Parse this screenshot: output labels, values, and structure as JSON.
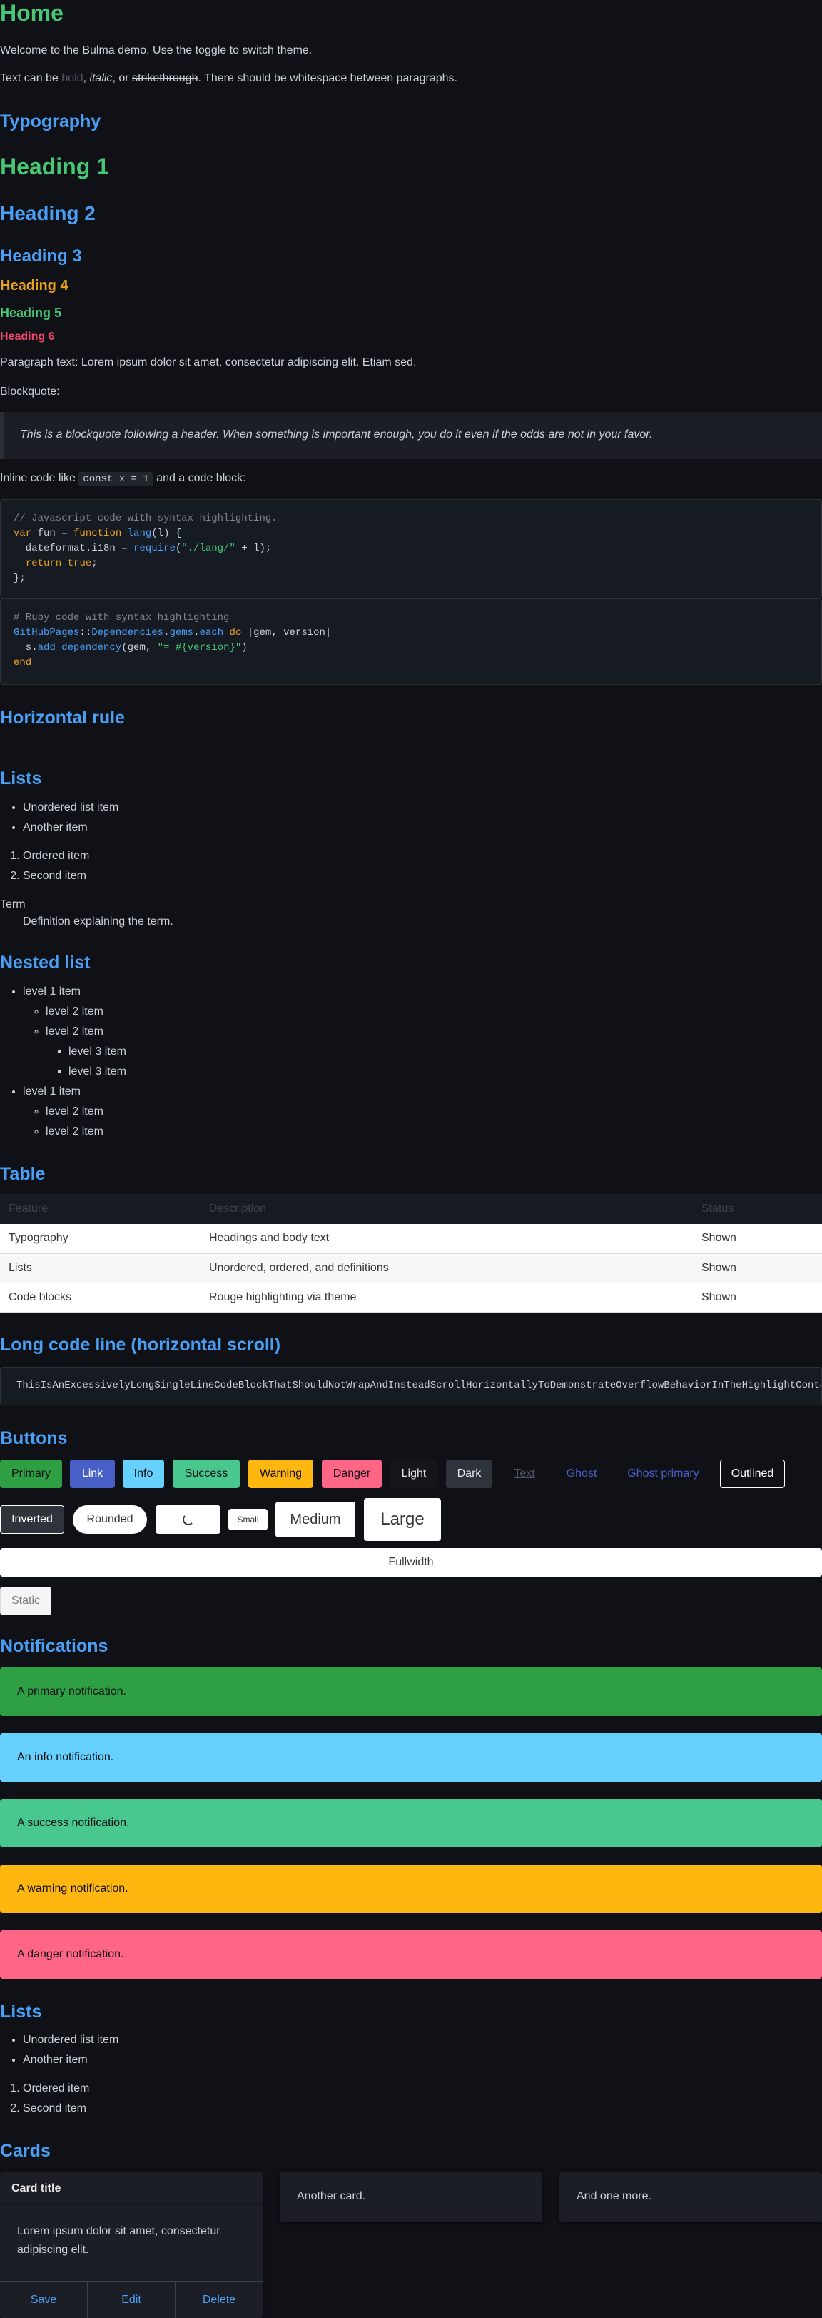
{
  "page": {
    "title": "Home",
    "intro": "Welcome to the Bulma demo. Use the toggle to switch theme.",
    "text_styles": {
      "prefix": "Text can be ",
      "bold": "bold",
      "comma1": ", ",
      "italic": "italic",
      "comma2": ", or ",
      "strike": "strikethrough",
      "suffix": ". There should be whitespace between paragraphs."
    }
  },
  "typography": {
    "heading": "Typography",
    "h1": "Heading 1",
    "h2": "Heading 2",
    "h3": "Heading 3",
    "h4": "Heading 4",
    "h5": "Heading 5",
    "h6": "Heading 6",
    "paragraph": "Paragraph text: Lorem ipsum dolor sit amet, consectetur adipiscing elit. Etiam sed.",
    "blockquote_label": "Blockquote:",
    "blockquote": "This is a blockquote following a header. When something is important enough, you do it even if the odds are not in your favor.",
    "inline_prefix": "Inline code like ",
    "inline_code": "const x = 1",
    "inline_suffix": " and a code block:"
  },
  "code_js": {
    "comment": "// Javascript code with syntax highlighting.",
    "l2_var": "var",
    "l2_mid": " fun = ",
    "l2_function": "function",
    "l2_lang": "lang",
    "l2_end": "(l) {",
    "l3_a": "  dateformat.i18n = ",
    "l3_require": "require",
    "l3_b": "(",
    "l3_str": "\"./lang/\"",
    "l3_c": " + l);",
    "l4_return": "return",
    "l4_true": "true",
    "l4_end": ";",
    "l5": "};"
  },
  "code_ruby": {
    "comment": "# Ruby code with syntax highlighting",
    "l2_a": "GitHubPages",
    "l2_b": "::",
    "l2_c": "Dependencies",
    "l2_d": ".",
    "l2_e": "gems",
    "l2_f": ".",
    "l2_g": "each",
    "l2_h": " ",
    "l2_do": "do",
    "l2_rest": " |gem, version|",
    "l3_a": "  s.",
    "l3_fn": "add_dependency",
    "l3_b": "(gem, ",
    "l3_str": "\"= #{version}\"",
    "l3_c": ")",
    "l4": "end"
  },
  "hr": {
    "heading": "Horizontal rule"
  },
  "lists": {
    "heading": "Lists",
    "unordered": [
      "Unordered list item",
      "Another item"
    ],
    "ordered": [
      "Ordered item",
      "Second item"
    ],
    "dt": "Term",
    "dd": "Definition explaining the term."
  },
  "nested": {
    "heading": "Nested list",
    "l1a": "level 1 item",
    "l2a": "level 2 item",
    "l2b": "level 2 item",
    "l3a": "level 3 item",
    "l3b": "level 3 item",
    "l1b": "level 1 item",
    "l2c": "level 2 item",
    "l2d": "level 2 item"
  },
  "table": {
    "heading": "Table",
    "columns": [
      "Feature",
      "Description",
      "Status"
    ],
    "rows": [
      [
        "Typography",
        "Headings and body text",
        "Shown"
      ],
      [
        "Lists",
        "Unordered, ordered, and definitions",
        "Shown"
      ],
      [
        "Code blocks",
        "Rouge highlighting via theme",
        "Shown"
      ]
    ]
  },
  "longcode": {
    "heading": "Long code line (horizontal scroll)",
    "code": "ThisIsAnExcessivelyLongSingleLineCodeBlockThatShouldNotWrapAndInsteadScrollHorizontallyToDemonstrateOverflowBehaviorInTheHighlightContainer"
  },
  "buttons": {
    "heading": "Buttons",
    "primary": "Primary",
    "link": "Link",
    "info": "Info",
    "success": "Success",
    "warning": "Warning",
    "danger": "Danger",
    "light": "Light",
    "dark": "Dark",
    "text": "Text",
    "ghost": "Ghost",
    "ghost_primary": "Ghost primary",
    "outlined": "Outlined",
    "inverted": "Inverted",
    "rounded": "Rounded",
    "small": "Small",
    "medium": "Medium",
    "large": "Large",
    "fullwidth": "Fullwidth",
    "static": "Static"
  },
  "notifications": {
    "heading": "Notifications",
    "primary": "A primary notification.",
    "info": "An info notification.",
    "success": "A success notification.",
    "warning": "A warning notification.",
    "danger": "A danger notification."
  },
  "lists2": {
    "heading": "Lists",
    "unordered": [
      "Unordered list item",
      "Another item"
    ],
    "ordered": [
      "Ordered item",
      "Second item"
    ]
  },
  "cards": {
    "heading": "Cards",
    "card1_title": "Card title",
    "card1_body": "Lorem ipsum dolor sit amet, consectetur adipiscing elit.",
    "save": "Save",
    "edit": "Edit",
    "delete": "Delete",
    "card2": "Another card.",
    "card3": "And one more."
  },
  "colors": {
    "primary": "#2ea043",
    "link": "#485fc7",
    "info": "#66d1ff",
    "success": "#48c78e",
    "warning": "#ffb70f",
    "danger": "#ff6685",
    "heading_blue": "#4a9ff5",
    "heading_green": "#48c774"
  }
}
